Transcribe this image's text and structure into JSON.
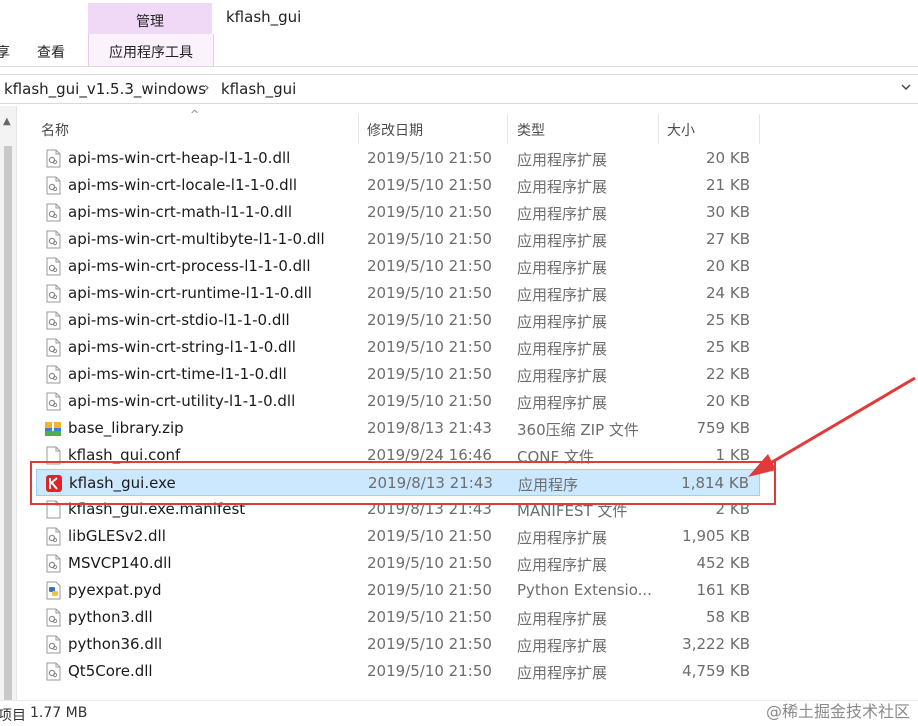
{
  "header": {
    "context_tab_label": "管理",
    "window_title": "kflash_gui",
    "ribbon_tabs": [
      {
        "label": "查看"
      },
      {
        "label": "应用程序工具"
      }
    ],
    "ribbon_partial_left": "享"
  },
  "address": {
    "crumbs": [
      "kflash_gui_v1.5.3_windows",
      "kflash_gui"
    ],
    "separator": "›"
  },
  "columns": {
    "name": "名称",
    "modified": "修改日期",
    "type": "类型",
    "size": "大小"
  },
  "files": [
    {
      "name": "api-ms-win-crt-heap-l1-1-0.dll",
      "date": "2019/5/10 21:50",
      "type": "应用程序扩展",
      "size": "20 KB",
      "icon": "dll-file-icon"
    },
    {
      "name": "api-ms-win-crt-locale-l1-1-0.dll",
      "date": "2019/5/10 21:50",
      "type": "应用程序扩展",
      "size": "21 KB",
      "icon": "dll-file-icon"
    },
    {
      "name": "api-ms-win-crt-math-l1-1-0.dll",
      "date": "2019/5/10 21:50",
      "type": "应用程序扩展",
      "size": "30 KB",
      "icon": "dll-file-icon"
    },
    {
      "name": "api-ms-win-crt-multibyte-l1-1-0.dll",
      "date": "2019/5/10 21:50",
      "type": "应用程序扩展",
      "size": "27 KB",
      "icon": "dll-file-icon"
    },
    {
      "name": "api-ms-win-crt-process-l1-1-0.dll",
      "date": "2019/5/10 21:50",
      "type": "应用程序扩展",
      "size": "20 KB",
      "icon": "dll-file-icon"
    },
    {
      "name": "api-ms-win-crt-runtime-l1-1-0.dll",
      "date": "2019/5/10 21:50",
      "type": "应用程序扩展",
      "size": "24 KB",
      "icon": "dll-file-icon"
    },
    {
      "name": "api-ms-win-crt-stdio-l1-1-0.dll",
      "date": "2019/5/10 21:50",
      "type": "应用程序扩展",
      "size": "25 KB",
      "icon": "dll-file-icon"
    },
    {
      "name": "api-ms-win-crt-string-l1-1-0.dll",
      "date": "2019/5/10 21:50",
      "type": "应用程序扩展",
      "size": "25 KB",
      "icon": "dll-file-icon"
    },
    {
      "name": "api-ms-win-crt-time-l1-1-0.dll",
      "date": "2019/5/10 21:50",
      "type": "应用程序扩展",
      "size": "22 KB",
      "icon": "dll-file-icon"
    },
    {
      "name": "api-ms-win-crt-utility-l1-1-0.dll",
      "date": "2019/5/10 21:50",
      "type": "应用程序扩展",
      "size": "20 KB",
      "icon": "dll-file-icon"
    },
    {
      "name": "base_library.zip",
      "date": "2019/8/13 21:43",
      "type": "360压缩 ZIP 文件",
      "size": "759 KB",
      "icon": "zip-archive-icon"
    },
    {
      "name": "kflash_gui.conf",
      "date": "2019/9/24 16:46",
      "type": "CONF 文件",
      "size": "1 KB",
      "icon": "blank-file-icon"
    },
    {
      "name": "kflash_gui.exe",
      "date": "2019/8/13 21:43",
      "type": "应用程序",
      "size": "1,814 KB",
      "icon": "kflash-app-icon",
      "selected": true
    },
    {
      "name": "kflash_gui.exe.manifest",
      "date": "2019/8/13 21:43",
      "type": "MANIFEST 文件",
      "size": "2 KB",
      "icon": "blank-file-icon"
    },
    {
      "name": "libGLESv2.dll",
      "date": "2019/5/10 21:50",
      "type": "应用程序扩展",
      "size": "1,905 KB",
      "icon": "dll-file-icon"
    },
    {
      "name": "MSVCP140.dll",
      "date": "2019/5/10 21:50",
      "type": "应用程序扩展",
      "size": "452 KB",
      "icon": "dll-file-icon"
    },
    {
      "name": "pyexpat.pyd",
      "date": "2019/5/10 21:50",
      "type": "Python Extensio...",
      "size": "161 KB",
      "icon": "python-file-icon"
    },
    {
      "name": "python3.dll",
      "date": "2019/5/10 21:50",
      "type": "应用程序扩展",
      "size": "58 KB",
      "icon": "dll-file-icon"
    },
    {
      "name": "python36.dll",
      "date": "2019/5/10 21:50",
      "type": "应用程序扩展",
      "size": "3,222 KB",
      "icon": "dll-file-icon"
    },
    {
      "name": "Qt5Core.dll",
      "date": "2019/5/10 21:50",
      "type": "应用程序扩展",
      "size": "4,759 KB",
      "icon": "dll-file-icon"
    }
  ],
  "status": {
    "item_label": "项目",
    "size_label": "1.77 MB"
  },
  "watermark": "@稀土掘金技术社区",
  "colors": {
    "context_tab": "#f0d9f6",
    "selection_bg": "#cce8ff",
    "selection_border": "#99d1ff",
    "annotation_red": "#e03a3a"
  }
}
